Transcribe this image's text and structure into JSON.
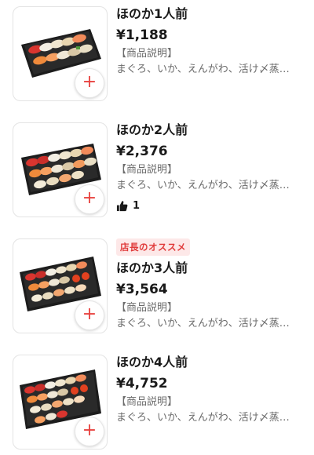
{
  "colors": {
    "accent": "#e8413e",
    "badge_bg": "#fde8e8",
    "badge_text": "#e03a3a",
    "muted_text": "#6b6b6b"
  },
  "items": [
    {
      "name": "ほのか1人前",
      "price": "¥1,188",
      "desc_label": "【商品説明】",
      "desc": "まぐろ、いか、えんがわ、活け〆蒸…",
      "add_icon": "+"
    },
    {
      "name": "ほのか2人前",
      "price": "¥2,376",
      "desc_label": "【商品説明】",
      "desc": "まぐろ、いか、えんがわ、活け〆蒸…",
      "likes": "1",
      "add_icon": "+"
    },
    {
      "badge": "店長のオススメ",
      "name": "ほのか3人前",
      "price": "¥3,564",
      "desc_label": "【商品説明】",
      "desc": "まぐろ、いか、えんがわ、活け〆蒸…",
      "add_icon": "+"
    },
    {
      "name": "ほのか4人前",
      "price": "¥4,752",
      "desc_label": "【商品説明】",
      "desc": "まぐろ、いか、えんがわ、活け〆蒸…",
      "add_icon": "+"
    }
  ]
}
